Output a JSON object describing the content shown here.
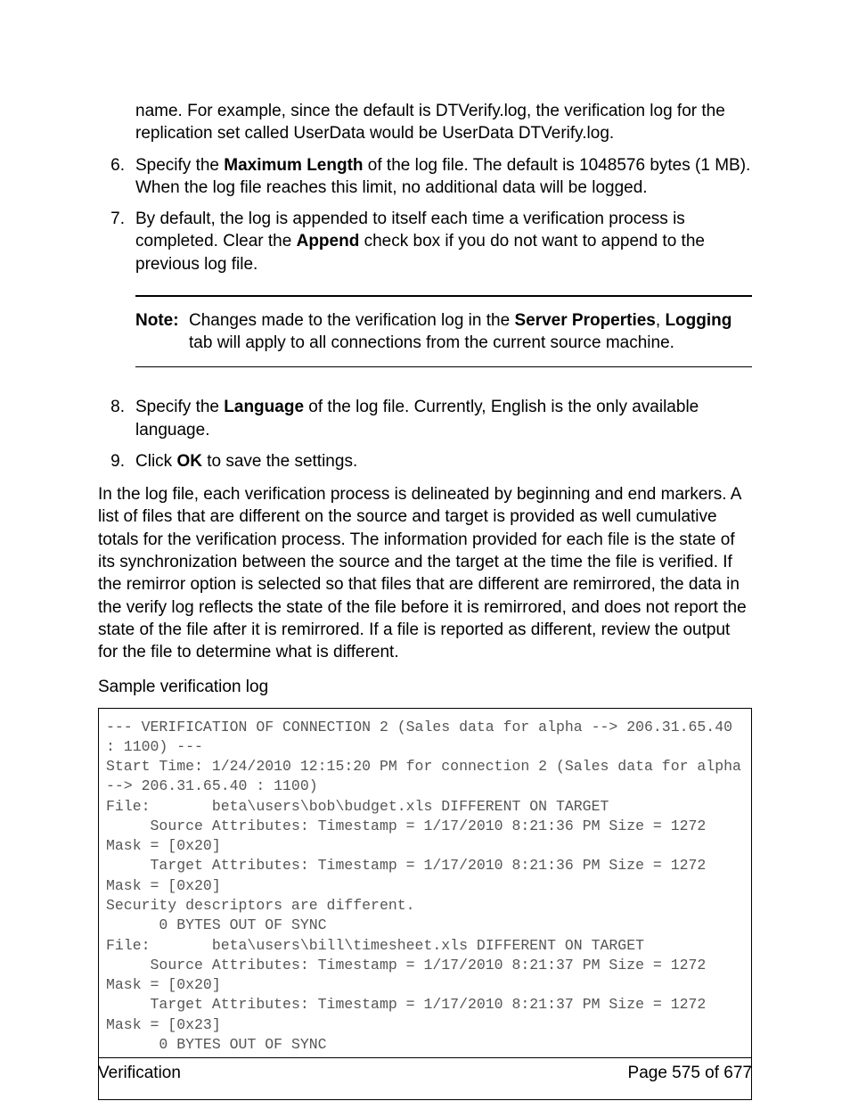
{
  "intro": {
    "para": "name. For example, since the default is DTVerify.log, the verification log for the replication set called UserData would be UserData DTVerify.log."
  },
  "items": {
    "i6": {
      "num": "6.",
      "pre": "Specify the ",
      "bold": "Maximum Length",
      "post": " of the log file. The default is 1048576 bytes (1 MB). When the log file reaches this limit, no additional data will be logged."
    },
    "i7": {
      "num": "7.",
      "pre": "By default, the log is appended to itself each time a verification process is completed. Clear the ",
      "bold": "Append",
      "post": " check box if you do not want to append to the previous log file."
    },
    "i8": {
      "num": "8.",
      "pre": "Specify the ",
      "bold": "Language",
      "post": " of the log file. Currently, English is the only available language."
    },
    "i9": {
      "num": "9.",
      "pre": "Click ",
      "bold": "OK",
      "post": " to save the settings."
    }
  },
  "note": {
    "label": "Note:",
    "pre": "Changes made to the verification log in the ",
    "b1": "Server Properties",
    "comma": ", ",
    "b2": "Logging",
    "post": " tab will apply to all connections from the current source machine."
  },
  "body_para": "In the log file, each verification process is delineated by beginning and end markers. A list of files that are different on the source and target is provided as well cumulative totals for the verification process. The information provided for each file is the state of its synchronization between the source and the target at the time the file is verified. If the remirror option is selected so that files that are different are remirrored, the data in the verify log reflects the state of the file before it is remirrored, and does not report the state of the file after it is remirrored. If a file is reported as different, review the output for the file to determine what is different.",
  "sample_label": "Sample verification log",
  "code": "--- VERIFICATION OF CONNECTION 2 (Sales data for alpha --> 206.31.65.40 : 1100) ---\nStart Time: 1/24/2010 12:15:20 PM for connection 2 (Sales data for alpha --> 206.31.65.40 : 1100)\nFile:       beta\\users\\bob\\budget.xls DIFFERENT ON TARGET\n     Source Attributes: Timestamp = 1/17/2010 8:21:36 PM Size = 1272 Mask = [0x20]\n     Target Attributes: Timestamp = 1/17/2010 8:21:36 PM Size = 1272 Mask = [0x20]\nSecurity descriptors are different.\n      0 BYTES OUT OF SYNC\nFile:       beta\\users\\bill\\timesheet.xls DIFFERENT ON TARGET\n     Source Attributes: Timestamp = 1/17/2010 8:21:37 PM Size = 1272 Mask = [0x20]\n     Target Attributes: Timestamp = 1/17/2010 8:21:37 PM Size = 1272 Mask = [0x23]\n      0 BYTES OUT OF SYNC",
  "footer": {
    "left": "Verification",
    "right": "Page 575 of 677"
  }
}
